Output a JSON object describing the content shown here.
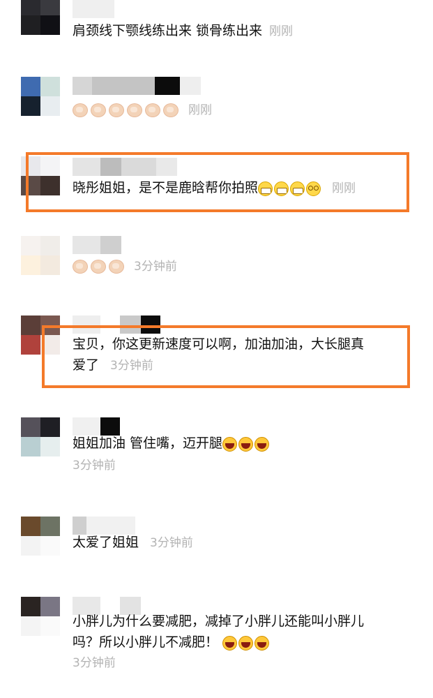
{
  "comments": [
    {
      "text": "肩颈线下颚线练出来 锁骨练出来",
      "time": "刚刚",
      "emoji": []
    },
    {
      "text": "",
      "time": "刚刚",
      "emoji": [
        "clap-emoji",
        "clap-emoji",
        "clap-emoji",
        "clap-emoji",
        "clap-emoji",
        "clap-emoji"
      ]
    },
    {
      "text": "晓彤姐姐，是不是鹿晗帮你拍照",
      "time": "刚刚",
      "emoji": [
        "grin-emoji",
        "grin-emoji",
        "grin-emoji",
        "dizzy-emoji"
      ],
      "highlighted": true
    },
    {
      "text": "",
      "time": "3分钟前",
      "emoji": [
        "clap-emoji",
        "clap-emoji",
        "clap-emoji"
      ]
    },
    {
      "text_line1": "宝贝，你这更新速度可以啊，加油加油，大长腿真",
      "text_line2": "爱了",
      "time": "3分钟前",
      "highlighted": true
    },
    {
      "text": "姐姐加油 管住嘴，迈开腿",
      "time": "3分钟前",
      "emoji": [
        "laugh-emoji",
        "laugh-emoji",
        "laugh-emoji"
      ]
    },
    {
      "text": "太爱了姐姐",
      "time": "3分钟前"
    },
    {
      "text_line1": "小胖儿为什么要减肥，减掉了小胖儿还能叫小胖儿",
      "text_line2": "吗？所以小胖儿不减肥！",
      "time": "3分钟前",
      "emoji": [
        "laugh-emoji",
        "laugh-emoji",
        "laugh-emoji"
      ]
    }
  ],
  "colors": {
    "highlight": "#f47a2a",
    "time": "#b3b3b3",
    "text": "#111111"
  }
}
